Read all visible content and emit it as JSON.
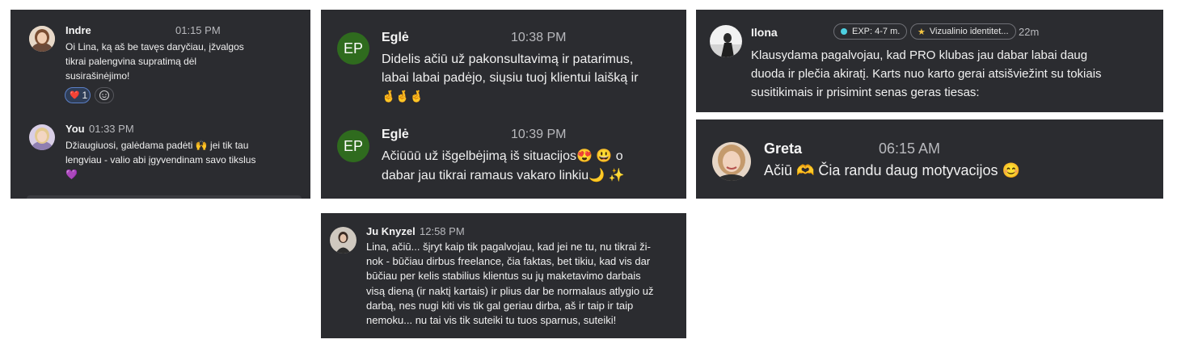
{
  "cards": {
    "indre": {
      "msg1": {
        "author": "Indre",
        "time": "01:15 PM",
        "lines": [
          "Oi Lina, ką aš be tavęs daryčiau, įžvalgos",
          "tikrai palengvina supratimą dėl",
          "susirašinėjimo!"
        ],
        "reaction_emoji": "❤️",
        "reaction_count": "1",
        "add_reaction_icon": "smiley-add-icon"
      },
      "msg2": {
        "author": "You",
        "time": "01:33 PM",
        "lines": [
          "Džiaugiuosi, galėdama padėti 🙌 jei tik tau",
          "lengviau - valio abi įgyvendinam savo tikslus",
          "💜"
        ]
      }
    },
    "egle": {
      "initials": "EP",
      "avatar_color": "#2f6b1e",
      "msg1": {
        "author": "Eglė",
        "time": "10:38 PM",
        "lines": [
          "Didelis ačiū už pakonsultavimą ir patarimus,",
          "labai labai padėjo, siųsiu tuoj klientui laišką ir",
          "🤞🤞🤞"
        ]
      },
      "msg2": {
        "author": "Eglė",
        "time": "10:39 PM",
        "lines": [
          "Ačiūūū už išgelbėjimą iš situacijos😍 😃 o",
          "dabar jau tikrai ramaus vakaro linkiu🌙 ✨"
        ]
      }
    },
    "ilona": {
      "author": "Ilona",
      "badge1": "EXP: 4-7 m.",
      "badge2": "Vizualinio identitet...",
      "badge1_color": "#4dd0e1",
      "badge2_color": "#f4c542",
      "time": "22m",
      "lines": [
        "Klausydama pagalvojau, kad PRO klubas jau dabar labai daug",
        "duoda ir plečia akiratį. Karts nuo karto gerai atsišviežint su tokiais",
        "susitikimais ir prisimint senas geras tiesas:"
      ]
    },
    "greta": {
      "author": "Greta",
      "time": "06:15 AM",
      "text": "Ačiū 🫶 Čia randu daug motyvacijos 😊"
    },
    "ju": {
      "author": "Ju Knyzel",
      "time": "12:58 PM",
      "lines": [
        "Lina, ačiū... šįryt kaip tik pagalvojau, kad jei ne tu, nu tikrai ži-",
        "nok - būčiau dirbus freelance, čia faktas, bet tikiu, kad vis dar",
        "būčiau per kelis stabilius klientus su jų maketavimo darbais",
        "visą dieną (ir naktį kartais) ir plius dar be normalaus atlygio už",
        "darbą, nes nugi kiti vis tik gal geriau dirba, aš ir taip ir taip",
        "nemoku... nu tai vis tik suteiki tu tuos sparnus, suteiki!"
      ]
    }
  }
}
